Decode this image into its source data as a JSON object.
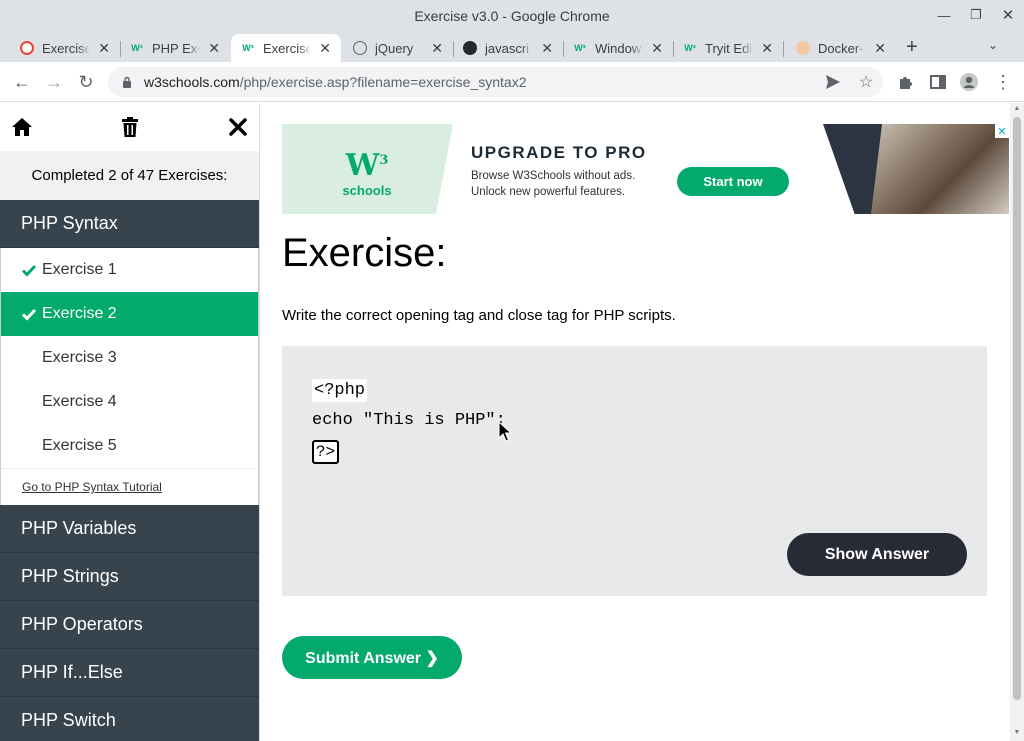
{
  "window": {
    "title": "Exercise v3.0 - Google Chrome"
  },
  "tabs": [
    {
      "label": "Exercise",
      "favicon": "circle-c-icon",
      "active": false
    },
    {
      "label": "PHP Exe",
      "favicon": "w3-icon",
      "active": false
    },
    {
      "label": "Exercise",
      "favicon": "w3-icon",
      "active": true
    },
    {
      "label": "jQuery",
      "favicon": "globe-icon",
      "active": false
    },
    {
      "label": "javascri",
      "favicon": "github-icon",
      "active": false
    },
    {
      "label": "Window",
      "favicon": "w3-icon",
      "active": false
    },
    {
      "label": "Tryit Edi",
      "favicon": "w3-icon",
      "active": false
    },
    {
      "label": "Docker-",
      "favicon": "avatar-icon",
      "active": false
    }
  ],
  "address": {
    "host": "w3schools.com",
    "path": "/php/exercise.asp?filename=exercise_syntax2"
  },
  "sidebar": {
    "completed_text": "Completed 2 of 47 Exercises:",
    "current_section": "PHP Syntax",
    "exercises": [
      {
        "label": "Exercise 1",
        "done": true,
        "active": false
      },
      {
        "label": "Exercise 2",
        "done": true,
        "active": true
      },
      {
        "label": "Exercise 3",
        "done": false,
        "active": false
      },
      {
        "label": "Exercise 4",
        "done": false,
        "active": false
      },
      {
        "label": "Exercise 5",
        "done": false,
        "active": false
      }
    ],
    "goto_link": "Go to PHP Syntax Tutorial",
    "sections": [
      "PHP Variables",
      "PHP Strings",
      "PHP Operators",
      "PHP If...Else",
      "PHP Switch"
    ]
  },
  "ad": {
    "logo_text": "W",
    "logo_sup": "3",
    "logo_sub": "schools",
    "headline": "UPGRADE TO PRO",
    "line1": "Browse W3Schools without ads.",
    "line2": "Unlock new powerful features.",
    "cta": "Start now",
    "close": "✕"
  },
  "exercise": {
    "title": "Exercise:",
    "description": "Write the correct opening tag and close tag for PHP scripts.",
    "code_line1": "<?php",
    "code_line2": "echo \"This is PHP\";",
    "input_value": "?>",
    "show_answer": "Show Answer",
    "submit": "Submit Answer ❯"
  },
  "colors": {
    "accent": "#04AA6D",
    "sidebar_dark": "#38444d",
    "code_bg": "#e7e9eb",
    "dark_button": "#282a35"
  }
}
